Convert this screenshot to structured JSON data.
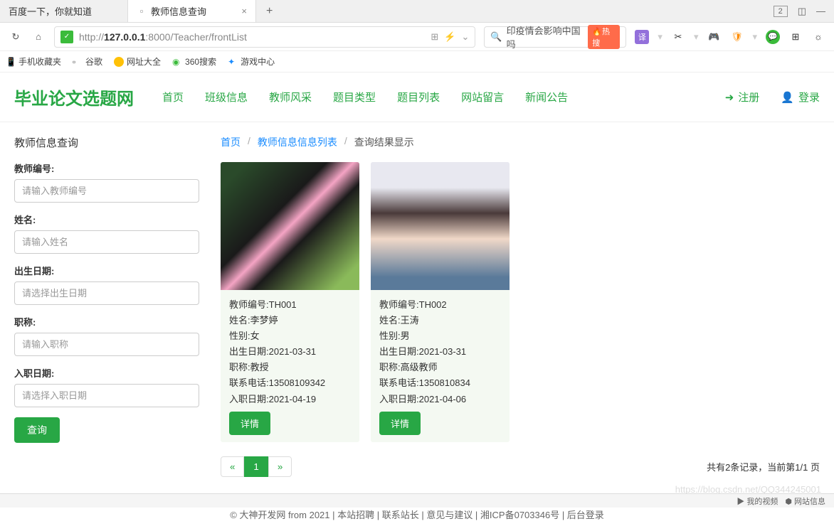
{
  "browser": {
    "tabs": [
      "百度一下，你就知道",
      "教师信息查询"
    ],
    "url_prefix": "http://",
    "url_host": "127.0.0.1",
    "url_port": ":8000",
    "url_path": "/Teacher/frontList",
    "search_hint": "印疫情会影响中国吗",
    "hot_label": "热搜",
    "win_badge": "2"
  },
  "bookmarks": [
    "手机收藏夹",
    "谷歌",
    "网址大全",
    "360搜索",
    "游戏中心"
  ],
  "site": {
    "logo": "毕业论文选题网",
    "nav": [
      "首页",
      "班级信息",
      "教师风采",
      "题目类型",
      "题目列表",
      "网站留言",
      "新闻公告"
    ],
    "register": "注册",
    "login": "登录"
  },
  "breadcrumb": {
    "home": "首页",
    "list": "教师信息信息列表",
    "result": "查询结果显示"
  },
  "search_form": {
    "title": "教师信息查询",
    "teacher_no_label": "教师编号:",
    "teacher_no_ph": "请输入教师编号",
    "name_label": "姓名:",
    "name_ph": "请输入姓名",
    "birth_label": "出生日期:",
    "birth_ph": "请选择出生日期",
    "title_label": "职称:",
    "title_ph": "请输入职称",
    "hire_label": "入职日期:",
    "hire_ph": "请选择入职日期",
    "query_btn": "查询"
  },
  "field_labels": {
    "teacher_no": "教师编号:",
    "name": "姓名:",
    "gender": "性别:",
    "birth": "出生日期:",
    "title": "职称:",
    "phone": "联系电话:",
    "hire": "入职日期:"
  },
  "teachers": [
    {
      "teacher_no": "TH001",
      "name": "李梦婷",
      "gender": "女",
      "birth": "2021-03-31",
      "title": "教授",
      "phone": "13508109342",
      "hire": "2021-04-19"
    },
    {
      "teacher_no": "TH002",
      "name": "王涛",
      "gender": "男",
      "birth": "2021-03-31",
      "title": "高级教师",
      "phone": "1350810834",
      "hire": "2021-04-06"
    }
  ],
  "detail_btn": "详情",
  "pagination": {
    "current": "1",
    "info": "共有2条记录，当前第1/1 页"
  },
  "footer": "© 大神开发网 from 2021 | 本站招聘 | 联系站长 | 意见与建议 | 湘ICP备0703346号 | 后台登录",
  "watermark": "https://blog.csdn.net/QQ344245001",
  "taskbar": [
    "我的视频",
    "网站信息"
  ]
}
